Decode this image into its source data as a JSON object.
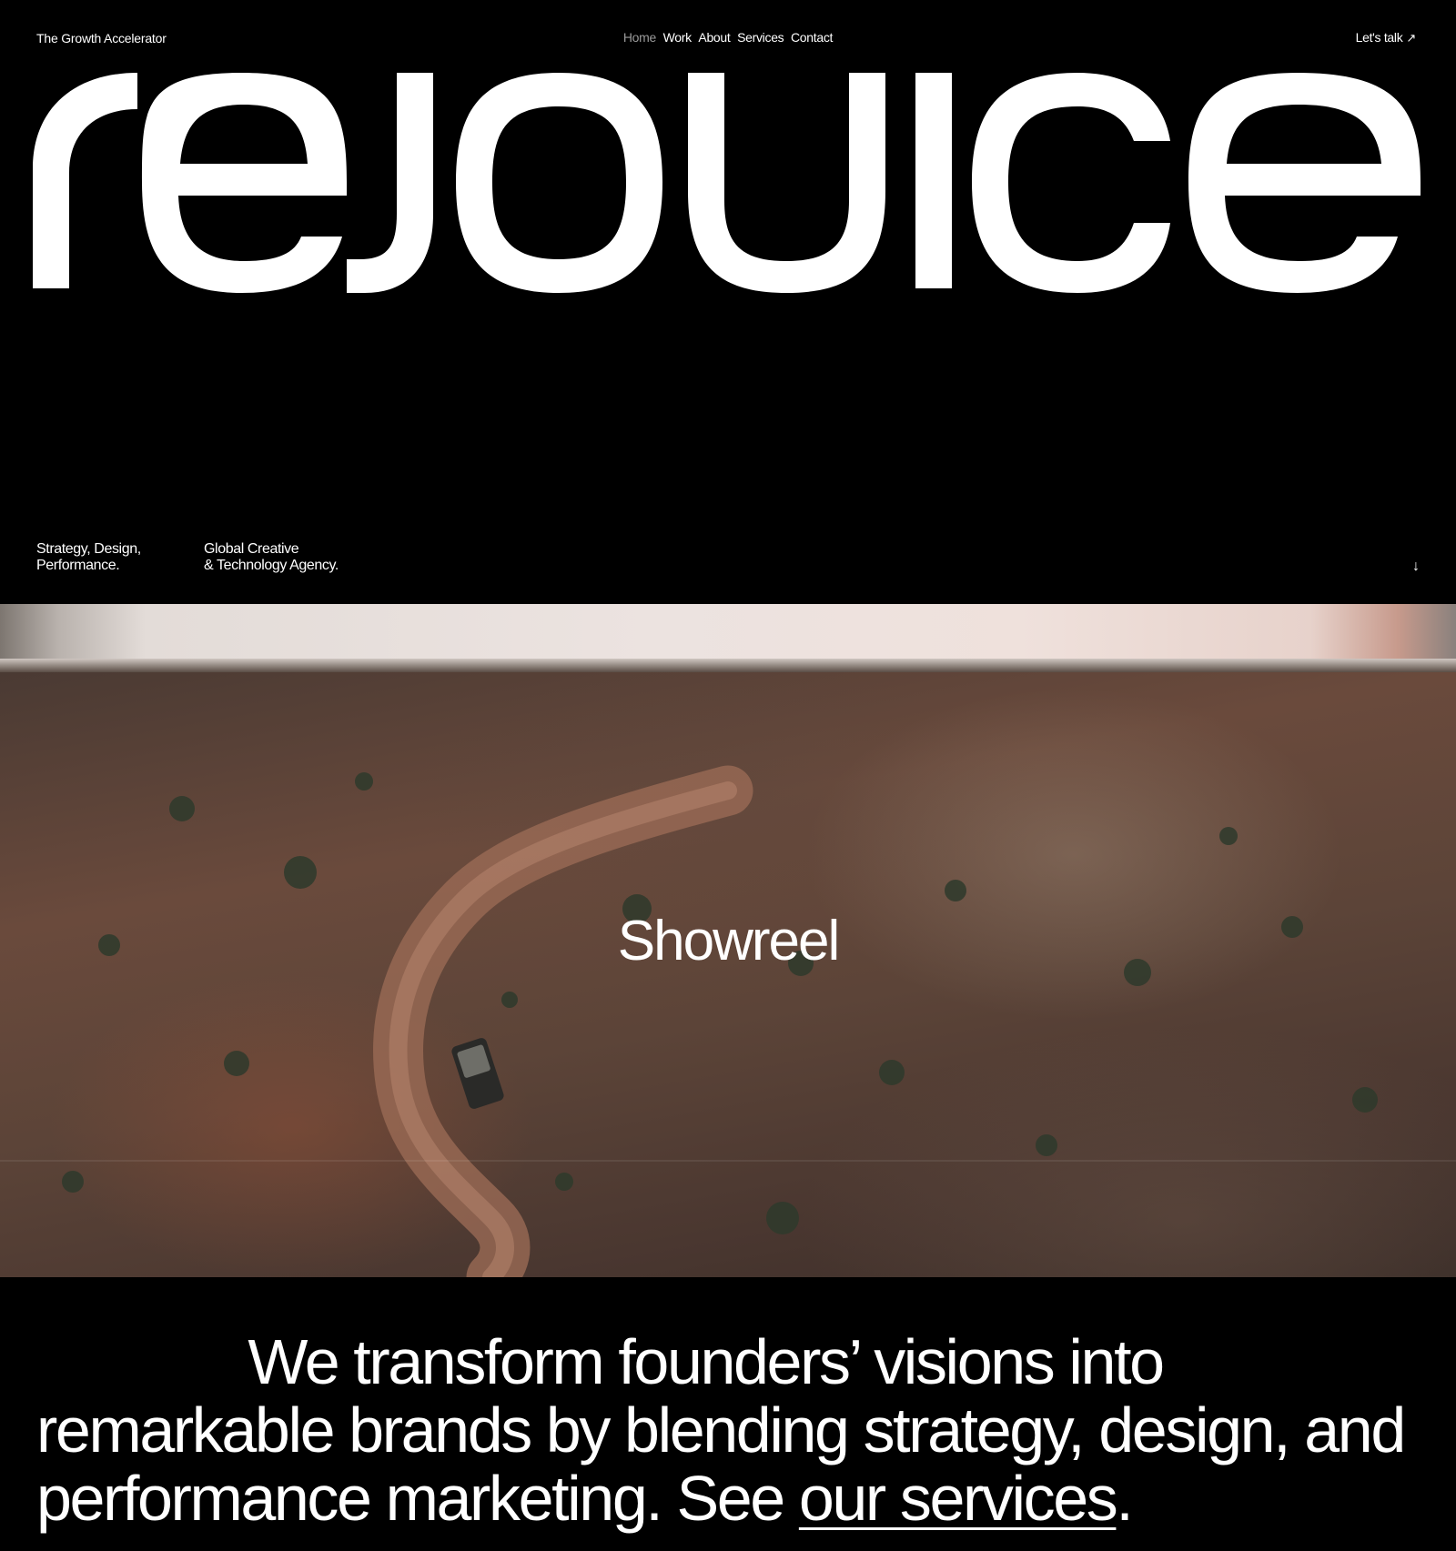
{
  "header": {
    "brand_tag": "The Growth Accelerator",
    "nav": [
      "Home",
      "Work",
      "About",
      "Services",
      "Contact"
    ],
    "active_nav": "Home",
    "cta_label": "Let's talk",
    "cta_icon": "arrow-up-right-icon"
  },
  "wordmark": {
    "text": "rejouice"
  },
  "taglines": {
    "left_line1": "Strategy, Design,",
    "left_line2": "Performance.",
    "right_line1": "Global Creative",
    "right_line2": "& Technology Agency.",
    "scroll_icon": "arrow-down-icon"
  },
  "showreel": {
    "label": "Showreel"
  },
  "statement": {
    "line1": "We transform founders’ visions into",
    "text_rest": "remarkable brands by blending strategy, design, and performance marketing. See ",
    "link_label": "our services",
    "end": "."
  },
  "colors": {
    "background": "#000000",
    "text": "#ffffff",
    "muted_nav": "#9a9a9a"
  }
}
